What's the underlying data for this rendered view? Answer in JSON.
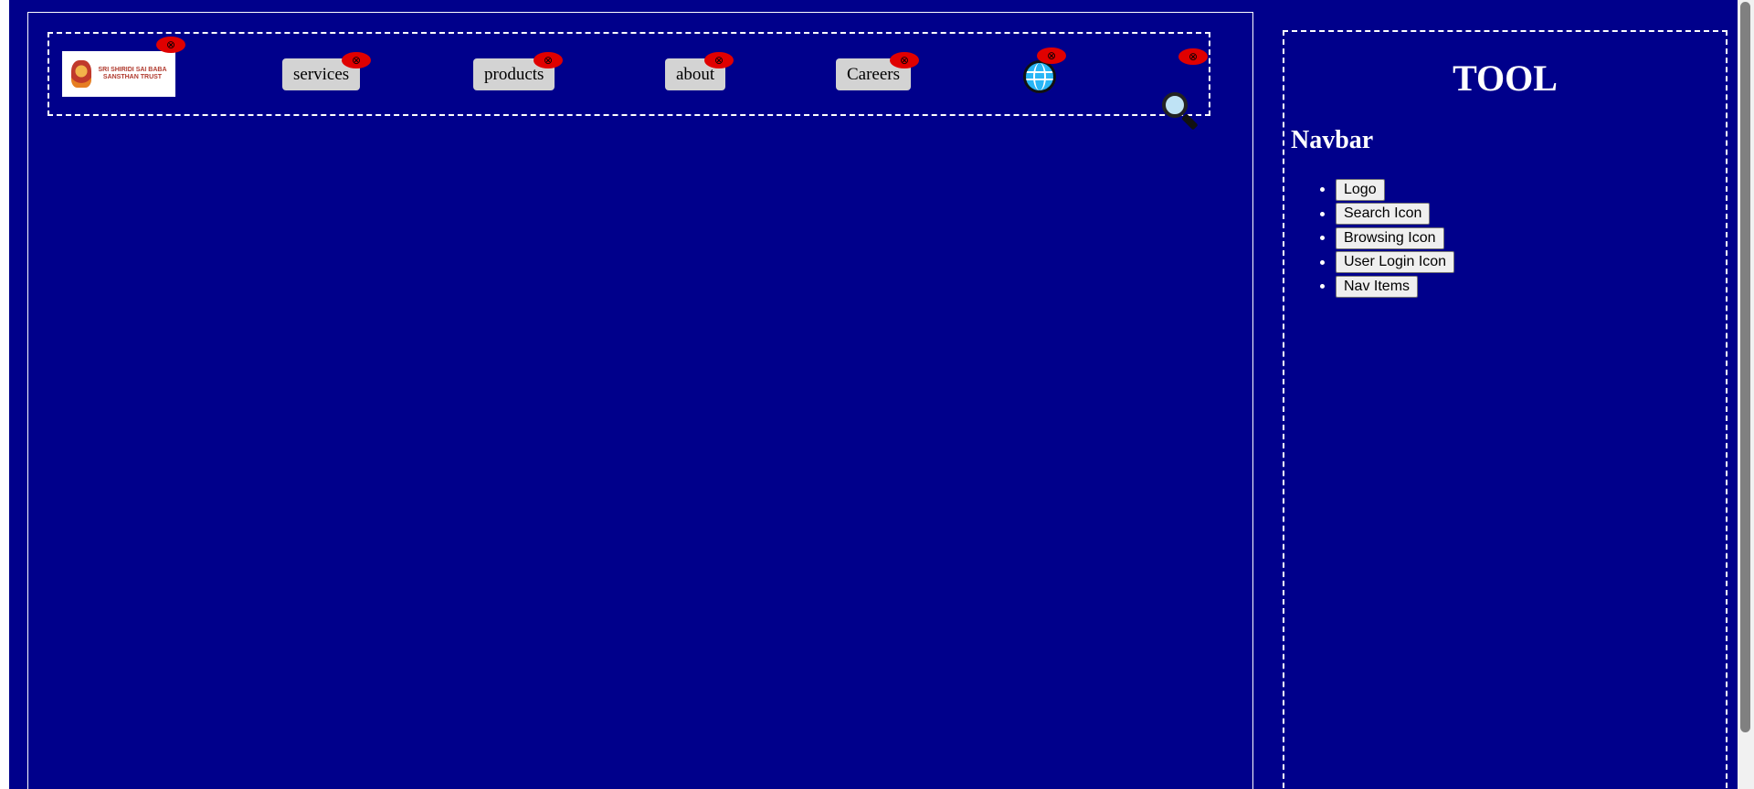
{
  "navbar": {
    "logo": {
      "text": "SRI SHIRIDI SAI BABA SANSTHAN TRUST",
      "remove_glyph": "⊗"
    },
    "items": [
      {
        "label": "services",
        "remove_glyph": "⊗"
      },
      {
        "label": "products",
        "remove_glyph": "⊗"
      },
      {
        "label": "about",
        "remove_glyph": "⊗"
      },
      {
        "label": "Careers",
        "remove_glyph": "⊗"
      }
    ],
    "globe": {
      "icon": "globe-icon",
      "remove_glyph": "⊗"
    },
    "search": {
      "icon": "search-icon",
      "remove_glyph": "⊗"
    }
  },
  "tool": {
    "title": "TOOL",
    "section_title": "Navbar",
    "buttons": [
      "Logo",
      "Search Icon",
      "Browsing Icon",
      "User Login Icon",
      "Nav Items"
    ]
  },
  "colors": {
    "background": "#00008b",
    "nav_button": "#d3d3d3",
    "remove_badge": "#e00000",
    "border": "#ffffff"
  }
}
